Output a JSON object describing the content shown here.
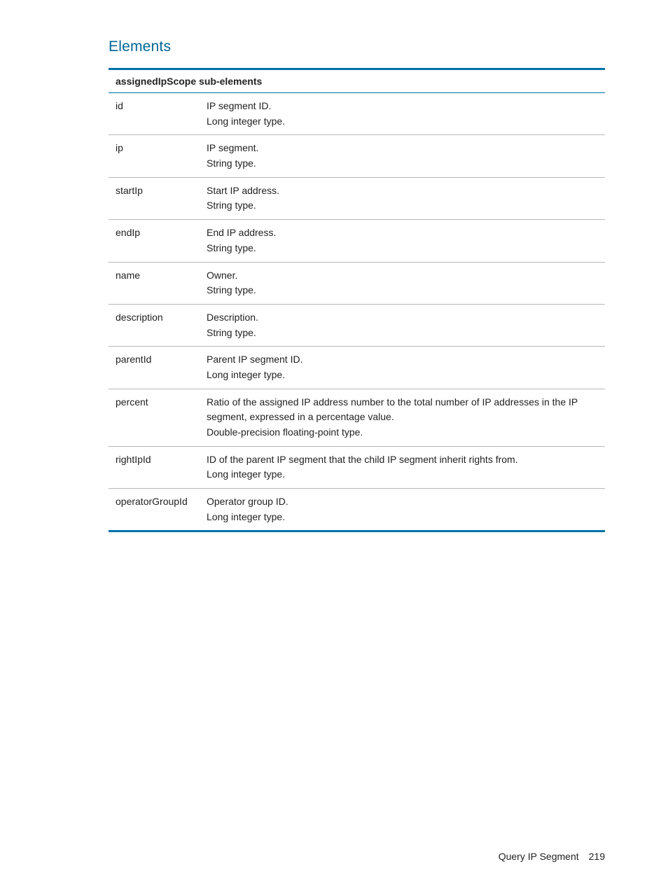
{
  "section_heading": "Elements",
  "table_header": "assignedIpScope sub-elements",
  "rows": [
    {
      "name": "id",
      "lines": [
        "IP segment ID.",
        "Long integer type."
      ]
    },
    {
      "name": "ip",
      "lines": [
        "IP segment.",
        "String type."
      ]
    },
    {
      "name": "startIp",
      "lines": [
        "Start IP address.",
        "String type."
      ]
    },
    {
      "name": "endIp",
      "lines": [
        "End IP address.",
        "String type."
      ]
    },
    {
      "name": "name",
      "lines": [
        "Owner.",
        "String type."
      ]
    },
    {
      "name": "description",
      "lines": [
        "Description.",
        "String type."
      ]
    },
    {
      "name": "parentId",
      "lines": [
        "Parent IP segment ID.",
        "Long integer type."
      ]
    },
    {
      "name": "percent",
      "lines": [
        "Ratio of the assigned IP address number to the total number of IP addresses in the IP segment, expressed in a percentage value.",
        "Double-precision floating-point type."
      ]
    },
    {
      "name": "rightIpId",
      "lines": [
        "ID of the parent IP segment that the child IP segment inherit rights from.",
        "Long integer type."
      ]
    },
    {
      "name": "operatorGroupId",
      "lines": [
        "Operator group ID.",
        "Long integer type."
      ]
    }
  ],
  "footer": {
    "section": "Query IP Segment",
    "page": "219"
  }
}
